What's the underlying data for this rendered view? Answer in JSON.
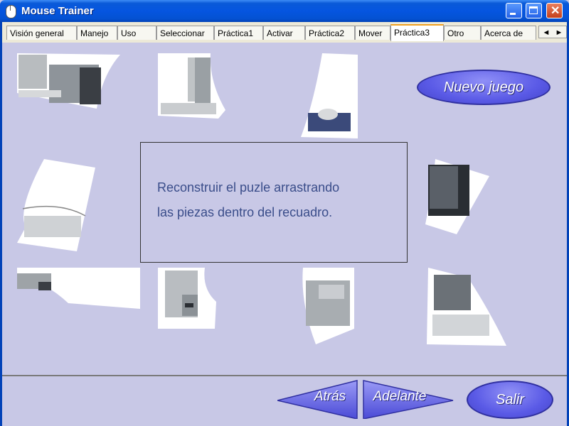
{
  "window": {
    "title": "Mouse Trainer"
  },
  "tabs": [
    {
      "label": "Visión general"
    },
    {
      "label": "Manejo"
    },
    {
      "label": "Uso"
    },
    {
      "label": "Seleccionar"
    },
    {
      "label": "Práctica1"
    },
    {
      "label": "Activar"
    },
    {
      "label": "Práctica2"
    },
    {
      "label": "Mover"
    },
    {
      "label": "Práctica3",
      "active": true
    },
    {
      "label": "Otro"
    },
    {
      "label": "Acerca de"
    }
  ],
  "tab_scroll": {
    "left": "◄",
    "right": "►"
  },
  "instruction": {
    "line1": "Reconstruir el puzle arrastrando",
    "line2": "las piezas dentro del recuadro."
  },
  "buttons": {
    "new_game": "Nuevo juego",
    "back": "Atrás",
    "forward": "Adelante",
    "exit": "Salir"
  },
  "colors": {
    "background": "#c8c8e6",
    "button_purple": "#5a5ae6",
    "text_blue": "#3a4d8a",
    "titlebar_blue": "#0555e0"
  }
}
